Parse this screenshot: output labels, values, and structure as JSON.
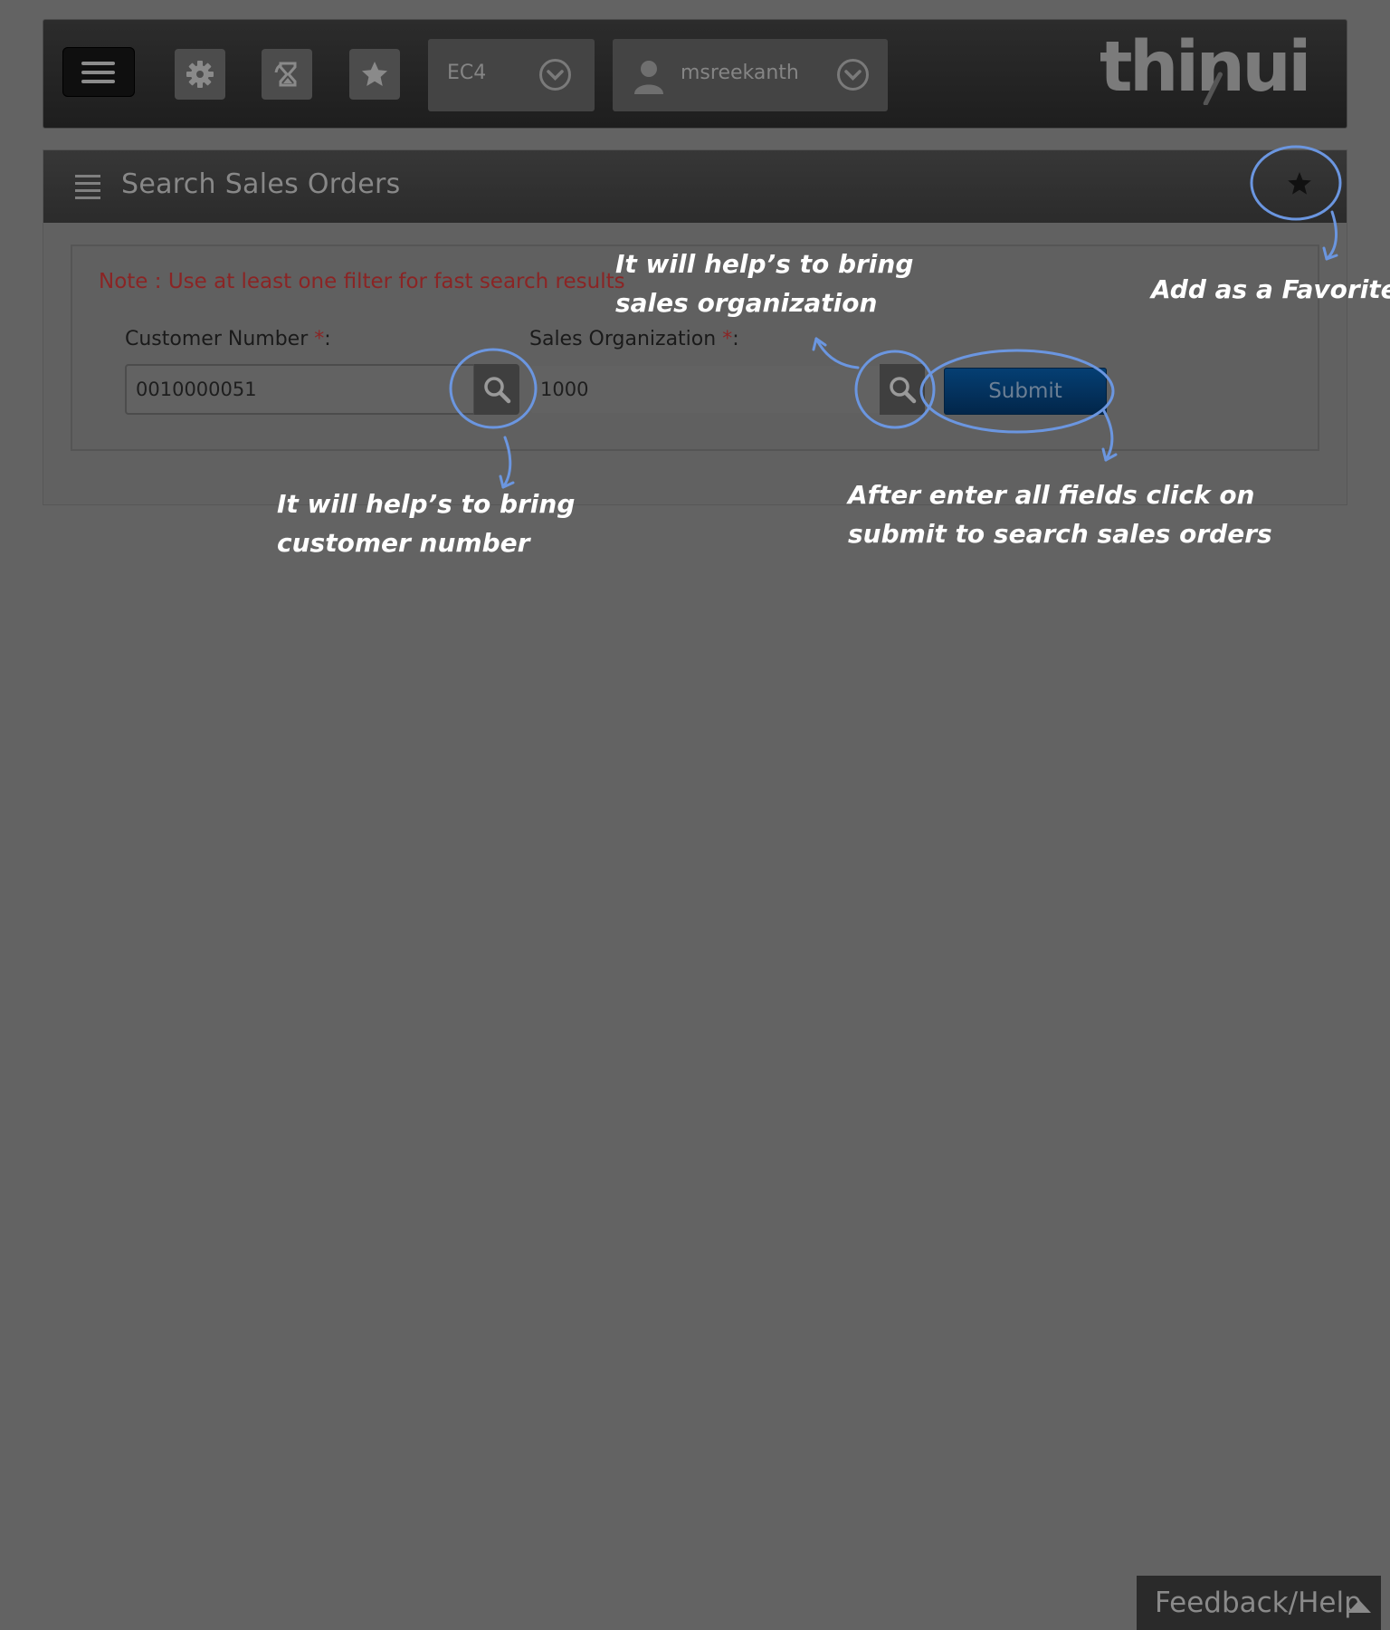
{
  "topbar": {
    "menu_icon": "hamburger-menu-icon",
    "tools": [
      {
        "icon": "gear-icon"
      },
      {
        "icon": "hourglass-icon"
      },
      {
        "icon": "star-icon"
      }
    ],
    "system_select": {
      "value": "EC4",
      "icon": "chevron-down-circle-icon"
    },
    "user_select": {
      "value": "msreekanth",
      "icon": "user-icon"
    },
    "logo_text": "thinui"
  },
  "panel": {
    "title": "Search Sales Orders",
    "note": "Note : Use at least one filter for fast search results",
    "customer": {
      "label": "Customer Number ",
      "required": "*",
      "suffix": ":",
      "value": "0010000051"
    },
    "sales_org": {
      "label": "Sales Organization ",
      "required": "*",
      "suffix": ":",
      "value": "1000"
    },
    "submit_label": "Submit"
  },
  "annotations": {
    "favorite": "Add as a Favorite",
    "sales_org_line1": "It will help’s to bring",
    "sales_org_line2": "sales organization",
    "customer_line1": "It will help’s to bring",
    "customer_line2": "customer number",
    "submit_line1": "After enter all fields click on",
    "submit_line2": "submit to search sales orders",
    "circle_color": "#6b96e0"
  },
  "feedback": {
    "label": "Feedback/Help",
    "icon": "caret-up-icon"
  }
}
